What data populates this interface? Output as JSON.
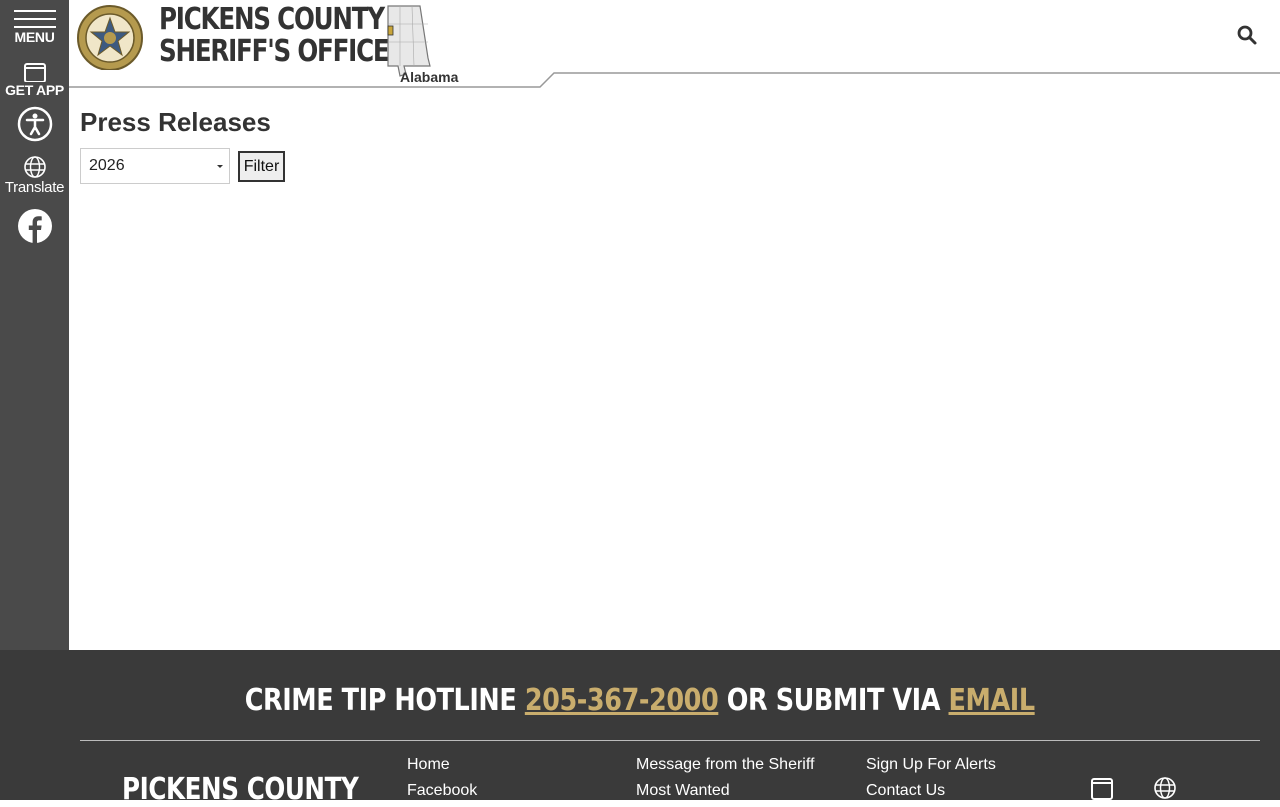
{
  "sidebar": {
    "menu_label": "MENU",
    "app_label": "GET APP",
    "translate_label": "Translate"
  },
  "header": {
    "title_line1": "PICKENS COUNTY",
    "title_line2": "SHERIFF'S OFFICE",
    "state_label": "Alabama"
  },
  "main": {
    "page_title": "Press Releases",
    "year_select_value": "2026",
    "filter_label": "Filter"
  },
  "footer": {
    "hotline_prefix": "CRIME TIP HOTLINE",
    "hotline_phone": "205-367-2000",
    "hotline_middle": "OR SUBMIT VIA",
    "hotline_email": "EMAIL",
    "brand": "PICKENS COUNTY",
    "links_col1": [
      "Home",
      "Facebook"
    ],
    "links_col2": [
      "Message from the Sheriff",
      "Most Wanted"
    ],
    "links_col3": [
      "Sign Up For Alerts",
      "Contact Us"
    ]
  },
  "colors": {
    "sidebar_bg": "#4a4a4a",
    "footer_bg": "#3a3a3a",
    "accent_gold": "#c9ad6d"
  },
  "icons": [
    "menu-icon",
    "phone-app-icon",
    "accessibility-icon",
    "globe-icon",
    "facebook-icon",
    "search-icon"
  ]
}
